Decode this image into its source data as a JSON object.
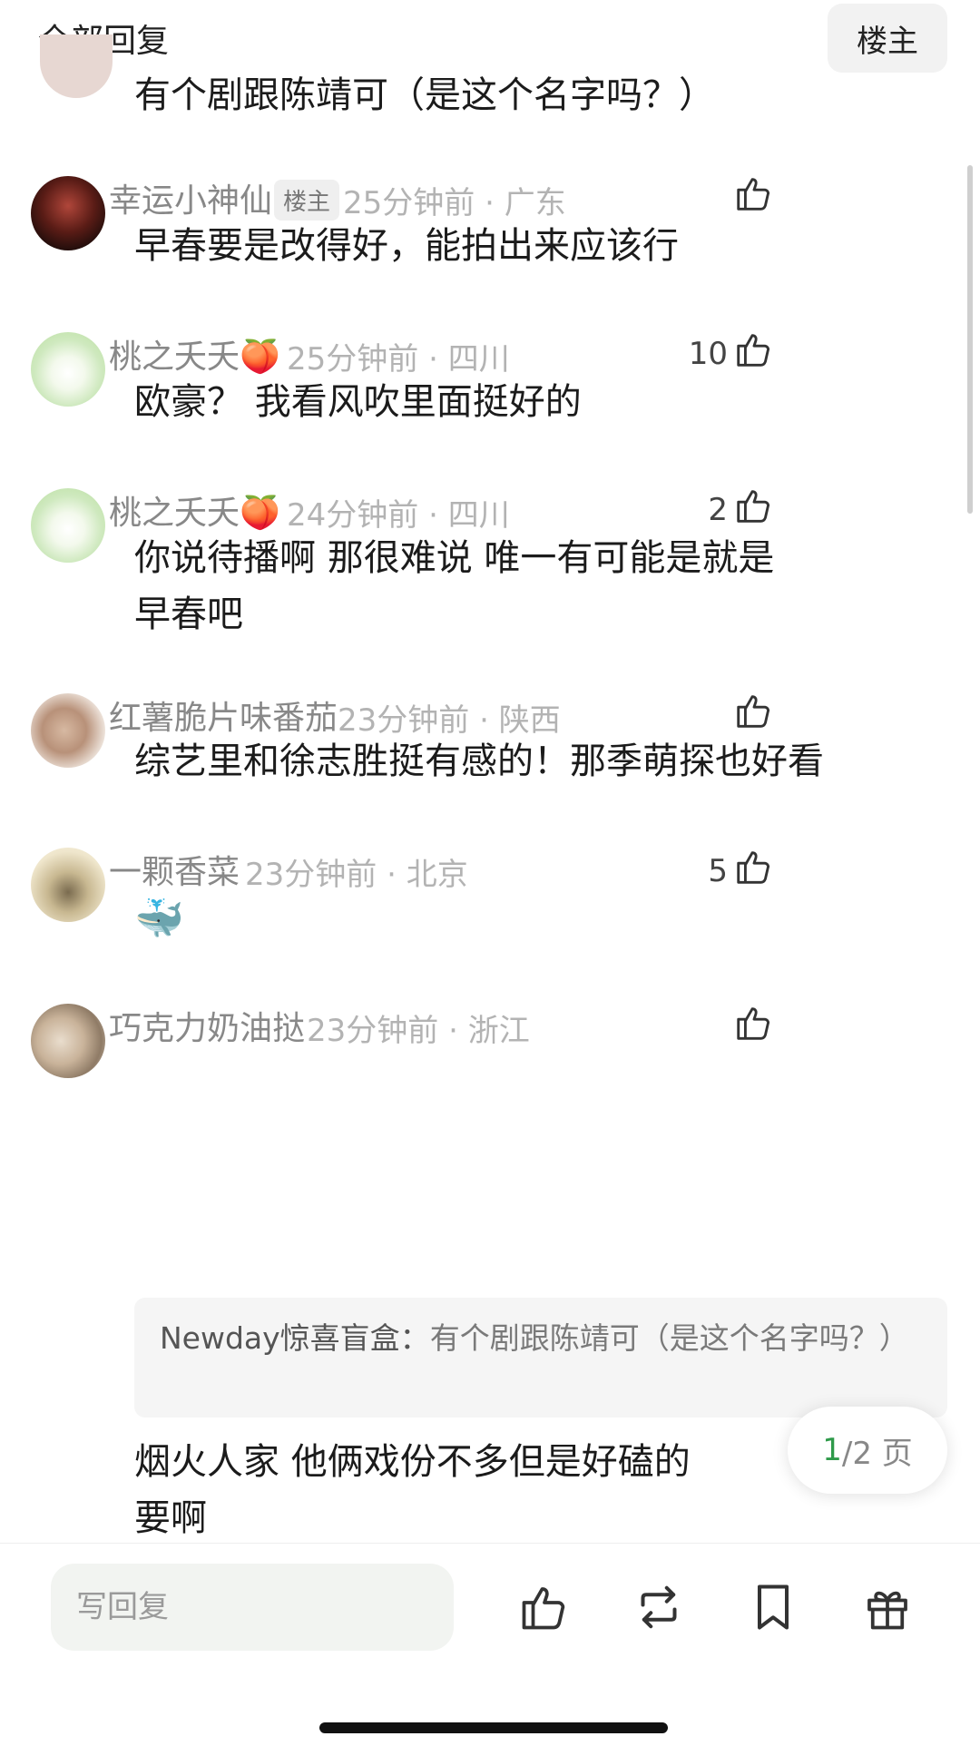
{
  "header": {
    "title": "全部回复",
    "op_toggle": "楼主"
  },
  "comments": [
    {
      "content": "有个剧跟陈靖可（是这个名字吗？）"
    },
    {
      "name": "幸运小神仙",
      "badge": "楼主",
      "time": "25分钟前",
      "location": "广东",
      "content": "早春要是改得好，能拍出来应该行",
      "likes": ""
    },
    {
      "name": "桃之夭夭🍑",
      "time": "25分钟前",
      "location": "四川",
      "content": "欧豪？ 我看风吹里面挺好的",
      "likes": "10"
    },
    {
      "name": "桃之夭夭🍑",
      "time": "24分钟前",
      "location": "四川",
      "content": "你说待播啊 那很难说 唯一有可能是就是早春吧",
      "likes": "2"
    },
    {
      "name": "红薯脆片味番茄",
      "time": "23分钟前",
      "location": "陕西",
      "content": "综艺里和徐志胜挺有感的！那季萌探也好看",
      "likes": ""
    },
    {
      "name": "一颗香菜",
      "time": "23分钟前",
      "location": "北京",
      "content": "🐳",
      "likes": "5"
    },
    {
      "name": "巧克力奶油挞",
      "time": "23分钟前",
      "location": "浙江",
      "quote_name": "Newday惊喜盲盒：",
      "quote_text": "有个剧跟陈靖可（是这个名字吗？）",
      "content": "烟火人家 他俩戏份不多但是好磕的要啊",
      "likes": ""
    }
  ],
  "pager": {
    "current": "1",
    "total_text": "/2 页"
  },
  "bottom_bar": {
    "reply_placeholder": "写回复"
  },
  "icons": {
    "like": "thumb-up-icon",
    "repost": "repost-icon",
    "bookmark": "bookmark-icon",
    "gift": "gift-icon"
  },
  "colors": {
    "accent_green": "#2f9a4a",
    "meta_gray": "#b3b3b3"
  }
}
